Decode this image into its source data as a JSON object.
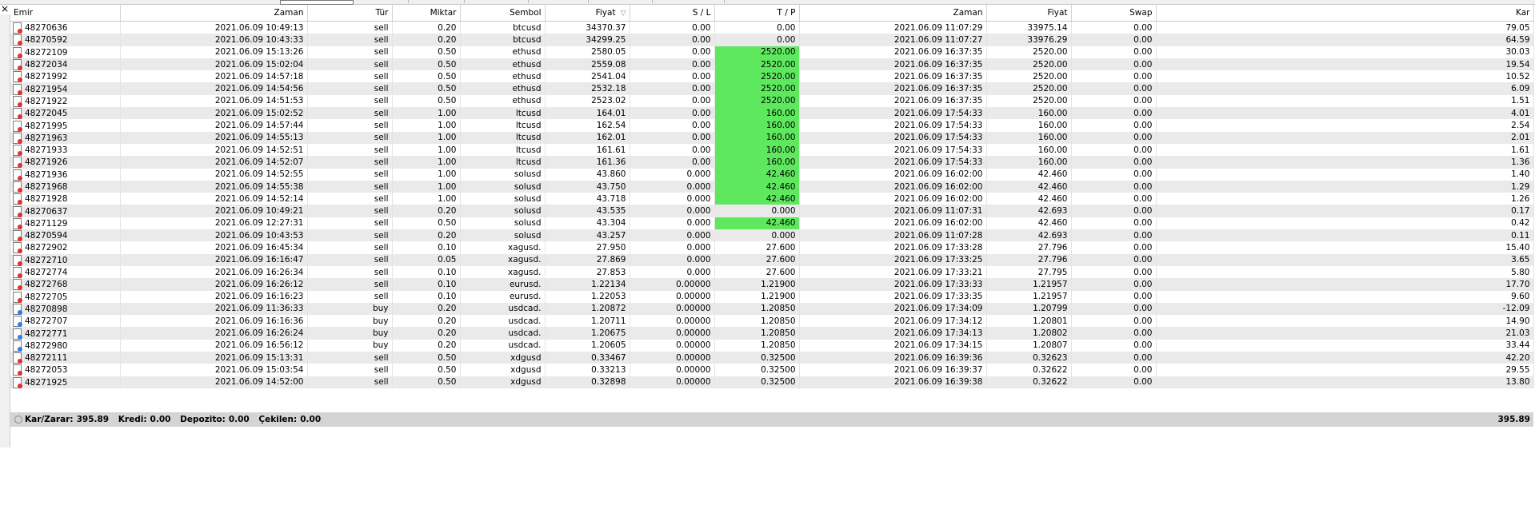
{
  "columns": [
    "Emir",
    "Zaman",
    "Tür",
    "Miktar",
    "Sembol",
    "Fiyat",
    "S / L",
    "T / P",
    "Zaman",
    "Fiyat",
    "Swap",
    "Kar"
  ],
  "colors": {
    "tp_hit": "#5ee85e",
    "sell_dot": "#e03030",
    "buy_dot": "#2f7fe0",
    "summary_bg": "#d4d4d4"
  },
  "icons": {
    "sell": "sell-order-icon",
    "buy": "buy-order-icon",
    "sort": "sort-desc-icon"
  },
  "rows": [
    {
      "order": "48270636",
      "open_time": "2021.06.09 10:49:13",
      "type": "sell",
      "volume": "0.20",
      "symbol": "btcusd",
      "open_price": "34370.37",
      "sl": "0.00",
      "tp": "0.00",
      "tp_hit": false,
      "close_time": "2021.06.09 11:07:29",
      "close_price": "33975.14",
      "swap": "0.00",
      "profit": "79.05"
    },
    {
      "order": "48270592",
      "open_time": "2021.06.09 10:43:33",
      "type": "sell",
      "volume": "0.20",
      "symbol": "btcusd",
      "open_price": "34299.25",
      "sl": "0.00",
      "tp": "0.00",
      "tp_hit": false,
      "close_time": "2021.06.09 11:07:27",
      "close_price": "33976.29",
      "swap": "0.00",
      "profit": "64.59"
    },
    {
      "order": "48272109",
      "open_time": "2021.06.09 15:13:26",
      "type": "sell",
      "volume": "0.50",
      "symbol": "ethusd",
      "open_price": "2580.05",
      "sl": "0.00",
      "tp": "2520.00",
      "tp_hit": true,
      "close_time": "2021.06.09 16:37:35",
      "close_price": "2520.00",
      "swap": "0.00",
      "profit": "30.03"
    },
    {
      "order": "48272034",
      "open_time": "2021.06.09 15:02:04",
      "type": "sell",
      "volume": "0.50",
      "symbol": "ethusd",
      "open_price": "2559.08",
      "sl": "0.00",
      "tp": "2520.00",
      "tp_hit": true,
      "close_time": "2021.06.09 16:37:35",
      "close_price": "2520.00",
      "swap": "0.00",
      "profit": "19.54"
    },
    {
      "order": "48271992",
      "open_time": "2021.06.09 14:57:18",
      "type": "sell",
      "volume": "0.50",
      "symbol": "ethusd",
      "open_price": "2541.04",
      "sl": "0.00",
      "tp": "2520.00",
      "tp_hit": true,
      "close_time": "2021.06.09 16:37:35",
      "close_price": "2520.00",
      "swap": "0.00",
      "profit": "10.52"
    },
    {
      "order": "48271954",
      "open_time": "2021.06.09 14:54:56",
      "type": "sell",
      "volume": "0.50",
      "symbol": "ethusd",
      "open_price": "2532.18",
      "sl": "0.00",
      "tp": "2520.00",
      "tp_hit": true,
      "close_time": "2021.06.09 16:37:35",
      "close_price": "2520.00",
      "swap": "0.00",
      "profit": "6.09"
    },
    {
      "order": "48271922",
      "open_time": "2021.06.09 14:51:53",
      "type": "sell",
      "volume": "0.50",
      "symbol": "ethusd",
      "open_price": "2523.02",
      "sl": "0.00",
      "tp": "2520.00",
      "tp_hit": true,
      "close_time": "2021.06.09 16:37:35",
      "close_price": "2520.00",
      "swap": "0.00",
      "profit": "1.51"
    },
    {
      "order": "48272045",
      "open_time": "2021.06.09 15:02:52",
      "type": "sell",
      "volume": "1.00",
      "symbol": "ltcusd",
      "open_price": "164.01",
      "sl": "0.00",
      "tp": "160.00",
      "tp_hit": true,
      "close_time": "2021.06.09 17:54:33",
      "close_price": "160.00",
      "swap": "0.00",
      "profit": "4.01"
    },
    {
      "order": "48271995",
      "open_time": "2021.06.09 14:57:44",
      "type": "sell",
      "volume": "1.00",
      "symbol": "ltcusd",
      "open_price": "162.54",
      "sl": "0.00",
      "tp": "160.00",
      "tp_hit": true,
      "close_time": "2021.06.09 17:54:33",
      "close_price": "160.00",
      "swap": "0.00",
      "profit": "2.54"
    },
    {
      "order": "48271963",
      "open_time": "2021.06.09 14:55:13",
      "type": "sell",
      "volume": "1.00",
      "symbol": "ltcusd",
      "open_price": "162.01",
      "sl": "0.00",
      "tp": "160.00",
      "tp_hit": true,
      "close_time": "2021.06.09 17:54:33",
      "close_price": "160.00",
      "swap": "0.00",
      "profit": "2.01"
    },
    {
      "order": "48271933",
      "open_time": "2021.06.09 14:52:51",
      "type": "sell",
      "volume": "1.00",
      "symbol": "ltcusd",
      "open_price": "161.61",
      "sl": "0.00",
      "tp": "160.00",
      "tp_hit": true,
      "close_time": "2021.06.09 17:54:33",
      "close_price": "160.00",
      "swap": "0.00",
      "profit": "1.61"
    },
    {
      "order": "48271926",
      "open_time": "2021.06.09 14:52:07",
      "type": "sell",
      "volume": "1.00",
      "symbol": "ltcusd",
      "open_price": "161.36",
      "sl": "0.00",
      "tp": "160.00",
      "tp_hit": true,
      "close_time": "2021.06.09 17:54:33",
      "close_price": "160.00",
      "swap": "0.00",
      "profit": "1.36"
    },
    {
      "order": "48271936",
      "open_time": "2021.06.09 14:52:55",
      "type": "sell",
      "volume": "1.00",
      "symbol": "solusd",
      "open_price": "43.860",
      "sl": "0.000",
      "tp": "42.460",
      "tp_hit": true,
      "close_time": "2021.06.09 16:02:00",
      "close_price": "42.460",
      "swap": "0.00",
      "profit": "1.40"
    },
    {
      "order": "48271968",
      "open_time": "2021.06.09 14:55:38",
      "type": "sell",
      "volume": "1.00",
      "symbol": "solusd",
      "open_price": "43.750",
      "sl": "0.000",
      "tp": "42.460",
      "tp_hit": true,
      "close_time": "2021.06.09 16:02:00",
      "close_price": "42.460",
      "swap": "0.00",
      "profit": "1.29"
    },
    {
      "order": "48271928",
      "open_time": "2021.06.09 14:52:14",
      "type": "sell",
      "volume": "1.00",
      "symbol": "solusd",
      "open_price": "43.718",
      "sl": "0.000",
      "tp": "42.460",
      "tp_hit": true,
      "close_time": "2021.06.09 16:02:00",
      "close_price": "42.460",
      "swap": "0.00",
      "profit": "1.26"
    },
    {
      "order": "48270637",
      "open_time": "2021.06.09 10:49:21",
      "type": "sell",
      "volume": "0.20",
      "symbol": "solusd",
      "open_price": "43.535",
      "sl": "0.000",
      "tp": "0.000",
      "tp_hit": false,
      "close_time": "2021.06.09 11:07:31",
      "close_price": "42.693",
      "swap": "0.00",
      "profit": "0.17"
    },
    {
      "order": "48271129",
      "open_time": "2021.06.09 12:27:31",
      "type": "sell",
      "volume": "0.50",
      "symbol": "solusd",
      "open_price": "43.304",
      "sl": "0.000",
      "tp": "42.460",
      "tp_hit": true,
      "close_time": "2021.06.09 16:02:00",
      "close_price": "42.460",
      "swap": "0.00",
      "profit": "0.42"
    },
    {
      "order": "48270594",
      "open_time": "2021.06.09 10:43:53",
      "type": "sell",
      "volume": "0.20",
      "symbol": "solusd",
      "open_price": "43.257",
      "sl": "0.000",
      "tp": "0.000",
      "tp_hit": false,
      "close_time": "2021.06.09 11:07:28",
      "close_price": "42.693",
      "swap": "0.00",
      "profit": "0.11"
    },
    {
      "order": "48272902",
      "open_time": "2021.06.09 16:45:34",
      "type": "sell",
      "volume": "0.10",
      "symbol": "xagusd.",
      "open_price": "27.950",
      "sl": "0.000",
      "tp": "27.600",
      "tp_hit": false,
      "close_time": "2021.06.09 17:33:28",
      "close_price": "27.796",
      "swap": "0.00",
      "profit": "15.40"
    },
    {
      "order": "48272710",
      "open_time": "2021.06.09 16:16:47",
      "type": "sell",
      "volume": "0.05",
      "symbol": "xagusd.",
      "open_price": "27.869",
      "sl": "0.000",
      "tp": "27.600",
      "tp_hit": false,
      "close_time": "2021.06.09 17:33:25",
      "close_price": "27.796",
      "swap": "0.00",
      "profit": "3.65"
    },
    {
      "order": "48272774",
      "open_time": "2021.06.09 16:26:34",
      "type": "sell",
      "volume": "0.10",
      "symbol": "xagusd.",
      "open_price": "27.853",
      "sl": "0.000",
      "tp": "27.600",
      "tp_hit": false,
      "close_time": "2021.06.09 17:33:21",
      "close_price": "27.795",
      "swap": "0.00",
      "profit": "5.80"
    },
    {
      "order": "48272768",
      "open_time": "2021.06.09 16:26:12",
      "type": "sell",
      "volume": "0.10",
      "symbol": "eurusd.",
      "open_price": "1.22134",
      "sl": "0.00000",
      "tp": "1.21900",
      "tp_hit": false,
      "close_time": "2021.06.09 17:33:33",
      "close_price": "1.21957",
      "swap": "0.00",
      "profit": "17.70"
    },
    {
      "order": "48272705",
      "open_time": "2021.06.09 16:16:23",
      "type": "sell",
      "volume": "0.10",
      "symbol": "eurusd.",
      "open_price": "1.22053",
      "sl": "0.00000",
      "tp": "1.21900",
      "tp_hit": false,
      "close_time": "2021.06.09 17:33:35",
      "close_price": "1.21957",
      "swap": "0.00",
      "profit": "9.60"
    },
    {
      "order": "48270898",
      "open_time": "2021.06.09 11:36:33",
      "type": "buy",
      "volume": "0.20",
      "symbol": "usdcad.",
      "open_price": "1.20872",
      "sl": "0.00000",
      "tp": "1.20850",
      "tp_hit": false,
      "close_time": "2021.06.09 17:34:09",
      "close_price": "1.20799",
      "swap": "0.00",
      "profit": "-12.09"
    },
    {
      "order": "48272707",
      "open_time": "2021.06.09 16:16:36",
      "type": "buy",
      "volume": "0.20",
      "symbol": "usdcad.",
      "open_price": "1.20711",
      "sl": "0.00000",
      "tp": "1.20850",
      "tp_hit": false,
      "close_time": "2021.06.09 17:34:12",
      "close_price": "1.20801",
      "swap": "0.00",
      "profit": "14.90"
    },
    {
      "order": "48272771",
      "open_time": "2021.06.09 16:26:24",
      "type": "buy",
      "volume": "0.20",
      "symbol": "usdcad.",
      "open_price": "1.20675",
      "sl": "0.00000",
      "tp": "1.20850",
      "tp_hit": false,
      "close_time": "2021.06.09 17:34:13",
      "close_price": "1.20802",
      "swap": "0.00",
      "profit": "21.03"
    },
    {
      "order": "48272980",
      "open_time": "2021.06.09 16:56:12",
      "type": "buy",
      "volume": "0.20",
      "symbol": "usdcad.",
      "open_price": "1.20605",
      "sl": "0.00000",
      "tp": "1.20850",
      "tp_hit": false,
      "close_time": "2021.06.09 17:34:15",
      "close_price": "1.20807",
      "swap": "0.00",
      "profit": "33.44"
    },
    {
      "order": "48272111",
      "open_time": "2021.06.09 15:13:31",
      "type": "sell",
      "volume": "0.50",
      "symbol": "xdgusd",
      "open_price": "0.33467",
      "sl": "0.00000",
      "tp": "0.32500",
      "tp_hit": false,
      "close_time": "2021.06.09 16:39:36",
      "close_price": "0.32623",
      "swap": "0.00",
      "profit": "42.20"
    },
    {
      "order": "48272053",
      "open_time": "2021.06.09 15:03:54",
      "type": "sell",
      "volume": "0.50",
      "symbol": "xdgusd",
      "open_price": "0.33213",
      "sl": "0.00000",
      "tp": "0.32500",
      "tp_hit": false,
      "close_time": "2021.06.09 16:39:37",
      "close_price": "0.32622",
      "swap": "0.00",
      "profit": "29.55"
    },
    {
      "order": "48271925",
      "open_time": "2021.06.09 14:52:00",
      "type": "sell",
      "volume": "0.50",
      "symbol": "xdgusd",
      "open_price": "0.32898",
      "sl": "0.00000",
      "tp": "0.32500",
      "tp_hit": false,
      "close_time": "2021.06.09 16:39:38",
      "close_price": "0.32622",
      "swap": "0.00",
      "profit": "13.80"
    }
  ],
  "summary": {
    "profit_label": "Kar/Zarar:",
    "profit_value": "395.89",
    "credit_label": "Kredi:",
    "credit_value": "0.00",
    "deposit_label": "Depozito:",
    "deposit_value": "0.00",
    "withdraw_label": "Çekilen:",
    "withdraw_value": "0.00",
    "total": "395.89"
  },
  "close_glyph": "×"
}
